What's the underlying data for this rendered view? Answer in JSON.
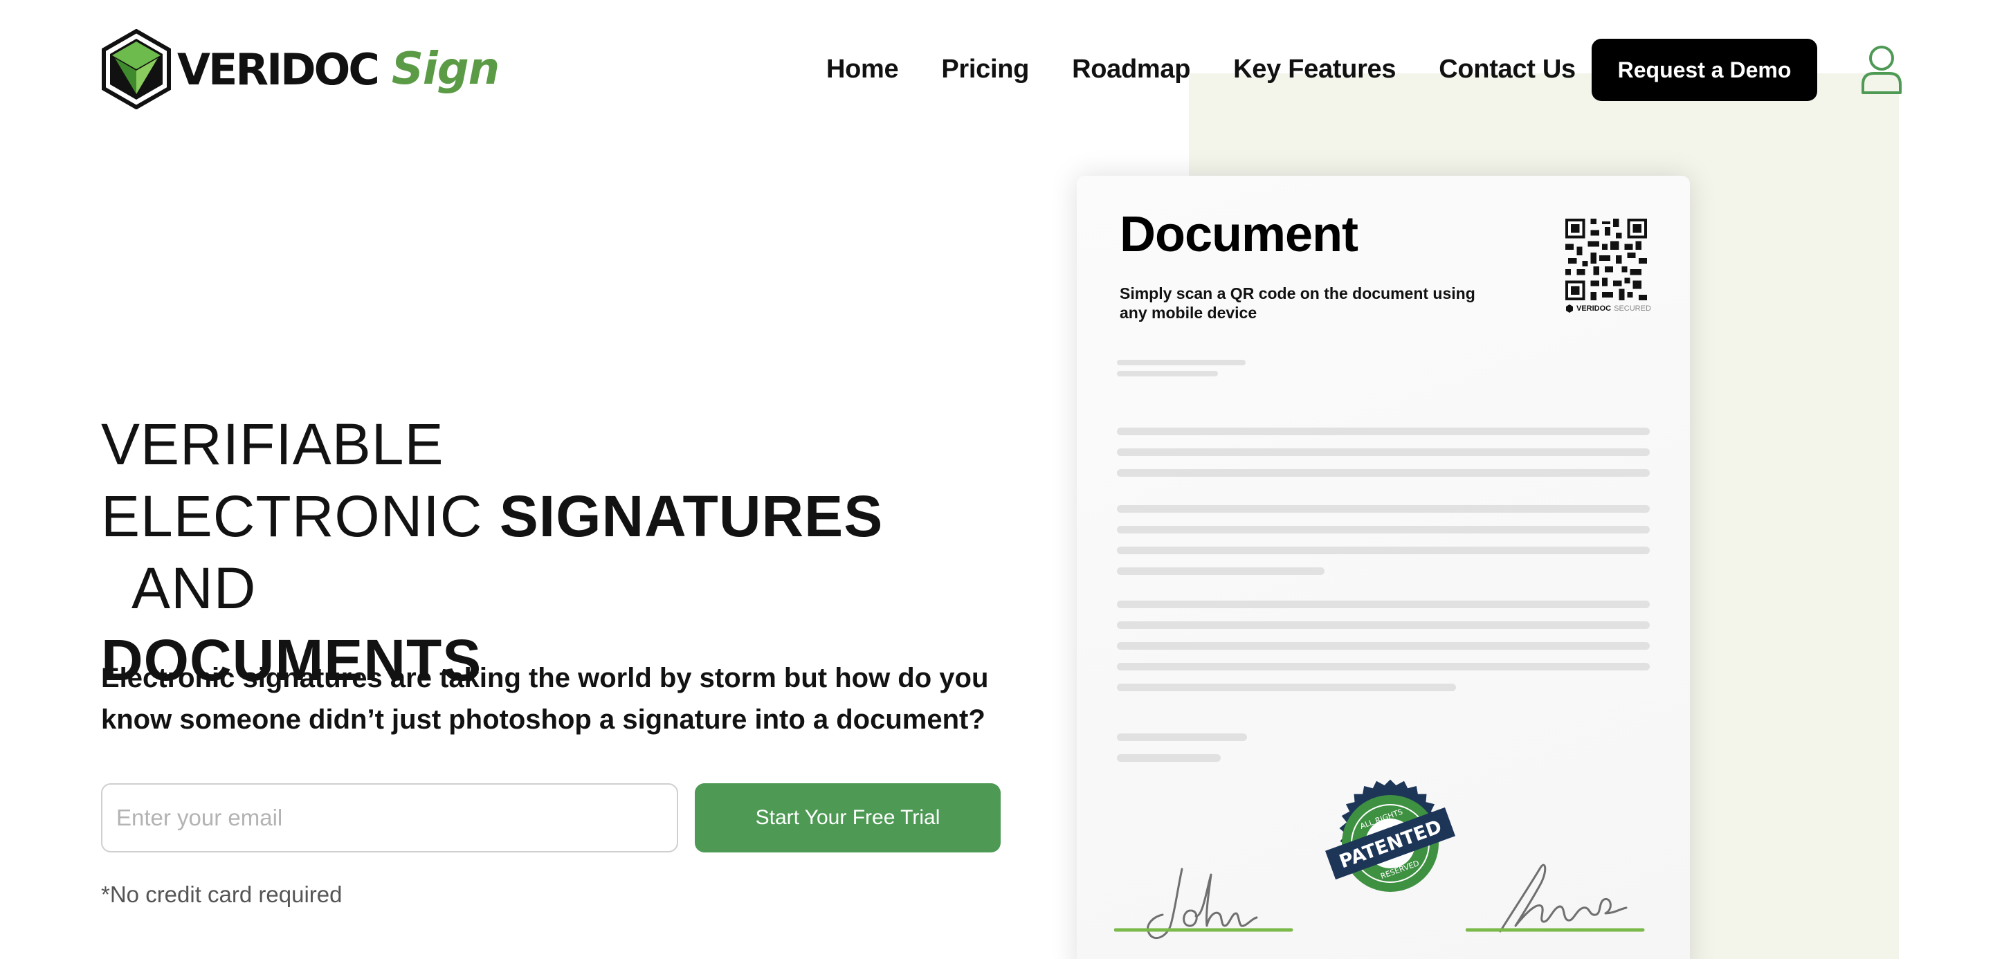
{
  "header": {
    "brand": "VERIDOC",
    "brand_sign": "Sign",
    "nav": [
      "Home",
      "Pricing",
      "Roadmap",
      "Key Features",
      "Contact Us"
    ],
    "demo_button": "Request a Demo"
  },
  "hero": {
    "title_line1": "VERIFIABLE",
    "title_line2_a": "ELECTRONIC ",
    "title_line2_b": "SIGNATURES",
    "title_line2_c": "  AND",
    "title_line3": "DOCUMENTS",
    "subtitle": "Electronic signatures are taking the world by storm but how do you know someone didn’t just photoshop a signature into a document?",
    "email_placeholder": "Enter your email",
    "trial_button": "Start Your Free Trial",
    "no_credit_card": "*No credit card required"
  },
  "document_card": {
    "title": "Document",
    "subtitle": "Simply scan a QR code on the document using any mobile device",
    "qr_caption_brand": "VERIDOC",
    "qr_caption_suffix": "SECURED",
    "seal_top": "ALL RIGHTS",
    "seal_center": "PATENTED",
    "seal_bottom": "RESERVED"
  },
  "colors": {
    "accent_green": "#4e9a55",
    "logo_green": "#5b9b45",
    "backdrop": "#f3f4ea",
    "seal_navy": "#1d3557"
  },
  "icons": [
    "veridoc-logo-icon",
    "user-icon",
    "qr-code-icon",
    "patented-seal-icon"
  ]
}
